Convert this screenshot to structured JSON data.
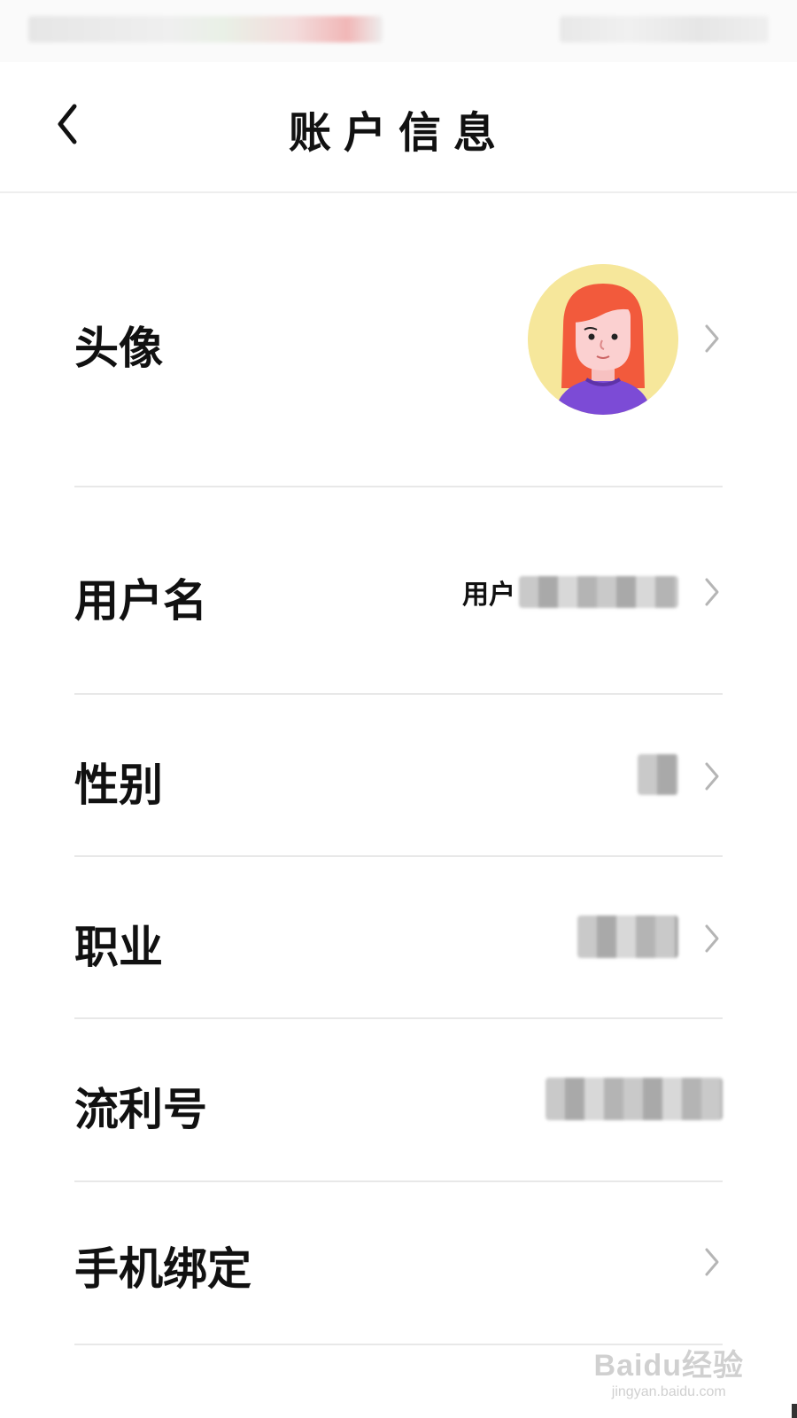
{
  "header": {
    "title": "账户信息",
    "back_icon": "chevron-left-icon"
  },
  "rows": {
    "avatar": {
      "label": "头像"
    },
    "username": {
      "label": "用户名",
      "value_prefix": "用户"
    },
    "gender": {
      "label": "性别"
    },
    "occupation": {
      "label": "职业"
    },
    "liuli_id": {
      "label": "流利号"
    },
    "phone": {
      "label": "手机绑定"
    }
  },
  "watermark": {
    "brand": "Baidu经验",
    "url": "jingyan.baidu.com"
  },
  "colors": {
    "avatar_bg": "#f6e79b",
    "hair": "#f25a3c",
    "shirt": "#7c4bd6",
    "chevron": "#b5b5b5",
    "divider": "#e8e8e8"
  }
}
